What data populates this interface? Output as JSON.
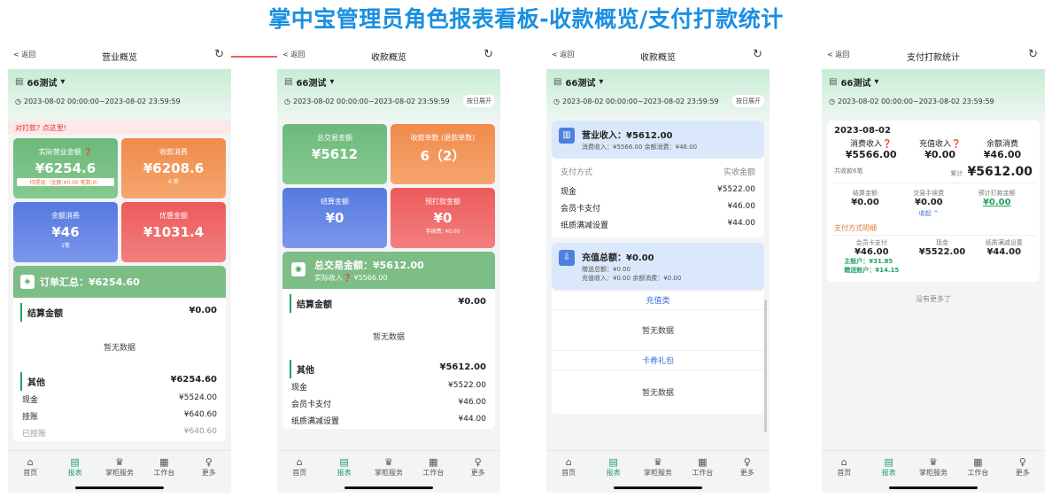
{
  "banner": "掌中宝管理员角色报表看板-收款概览/支付打款统计",
  "common": {
    "back": "< 返回",
    "shop": "66测试",
    "date_range": "2023-08-02 00:00:00~2023-08-02 23:59:59",
    "by_day": "按日展开",
    "refresh": "↻"
  },
  "tabs": [
    {
      "icon": "⌂",
      "label": "首页"
    },
    {
      "icon": "▤",
      "label": "报表"
    },
    {
      "icon": "♛",
      "label": "掌柜服务"
    },
    {
      "icon": "▦",
      "label": "工作台"
    },
    {
      "icon": "♀",
      "label": "更多"
    }
  ],
  "p1": {
    "title": "营业概览",
    "warn_text": "对打款?",
    "warn_link": "点这里!",
    "cards": [
      {
        "label": "实际营业金额 ❓",
        "value": "¥6254.6",
        "sub": "待提现（金额:¥0.00  笔数:0）"
      },
      {
        "label": "收款消费",
        "value": "¥6208.6",
        "sub": "6 笔"
      },
      {
        "label": "余额消费",
        "value": "¥46",
        "sub": "1笔"
      },
      {
        "label": "优惠金额",
        "value": "¥1031.4",
        "sub": ""
      }
    ],
    "summary": "订单汇总：¥6254.60",
    "settle_label": "结算金额",
    "settle_value": "¥0.00",
    "empty": "暂无数据",
    "other_label": "其他",
    "other_value": "¥6254.60",
    "rows": [
      {
        "k": "现金",
        "v": "¥5524.00"
      },
      {
        "k": "挂账",
        "v": "¥640.60"
      },
      {
        "k": "已挂账",
        "v": "¥640.60"
      }
    ]
  },
  "p2": {
    "title": "收款概览",
    "cards": [
      {
        "label": "总交易金额",
        "value": "¥5612",
        "sub": ""
      },
      {
        "label": "收款单数 (退款单数)",
        "value": "6（2）",
        "sub": ""
      },
      {
        "label": "结算金额",
        "value": "¥0",
        "sub": ""
      },
      {
        "label": "预打款金额",
        "value": "¥0",
        "sub": "手续费: ¥0.00"
      }
    ],
    "summary": "总交易金额：¥5612.00",
    "summary_sub": "实际收入❓ ¥5566.00",
    "settle_label": "结算金额",
    "settle_value": "¥0.00",
    "empty": "暂无数据",
    "other_label": "其他",
    "other_value": "¥5612.00",
    "rows": [
      {
        "k": "现金",
        "v": "¥5522.00"
      },
      {
        "k": "会员卡支付",
        "v": "¥46.00"
      },
      {
        "k": "纸质满减设置",
        "v": "¥44.00"
      }
    ]
  },
  "p3": {
    "title": "收款概览",
    "income_title": "营业收入：¥5612.00",
    "income_sub": "消费收入：¥5566.00    余额消费：¥46.00",
    "pay_method": "支付方式",
    "actual": "实收金额",
    "rows": [
      {
        "k": "现金",
        "v": "¥5522.00"
      },
      {
        "k": "会员卡支付",
        "v": "¥46.00"
      },
      {
        "k": "纸质满减设置",
        "v": "¥44.00"
      }
    ],
    "recharge_title": "充值总额：¥0.00",
    "recharge_sub1": "赠送总额：¥0.00",
    "recharge_sub2": "充值收入：¥0.00    余额消费：¥0.00",
    "sec1": "充值类",
    "sec2": "卡券礼包",
    "empty": "暂无数据"
  },
  "p4": {
    "title": "支付打款统计",
    "date": "2023-08-02",
    "top": [
      {
        "l": "消费收入❓",
        "v": "¥5566.00"
      },
      {
        "l": "充值收入❓",
        "v": "¥0.00"
      },
      {
        "l": "余额消费",
        "v": "¥46.00"
      }
    ],
    "count": "共收款6笔",
    "total_label": "累计",
    "total": "¥5612.00",
    "mid": [
      {
        "l": "结算金额",
        "v": "¥0.00"
      },
      {
        "l": "交易手续费",
        "v": "¥0.00"
      },
      {
        "l": "预计打款金额",
        "v": "¥0.00"
      }
    ],
    "collapse": "收起 ^",
    "detail": "支付方式明细",
    "bot": [
      {
        "l": "会员卡支付",
        "v": "¥46.00"
      },
      {
        "l": "现金",
        "v": "¥5522.00"
      },
      {
        "l": "纸质满减设置",
        "v": "¥44.00"
      }
    ],
    "main_acct": "主账户：¥31.85",
    "gift_acct": "赠送账户：¥14.15",
    "no_more": "没有更多了"
  },
  "colors": {
    "green": "#22a160",
    "banner": "#1a8fe0"
  }
}
